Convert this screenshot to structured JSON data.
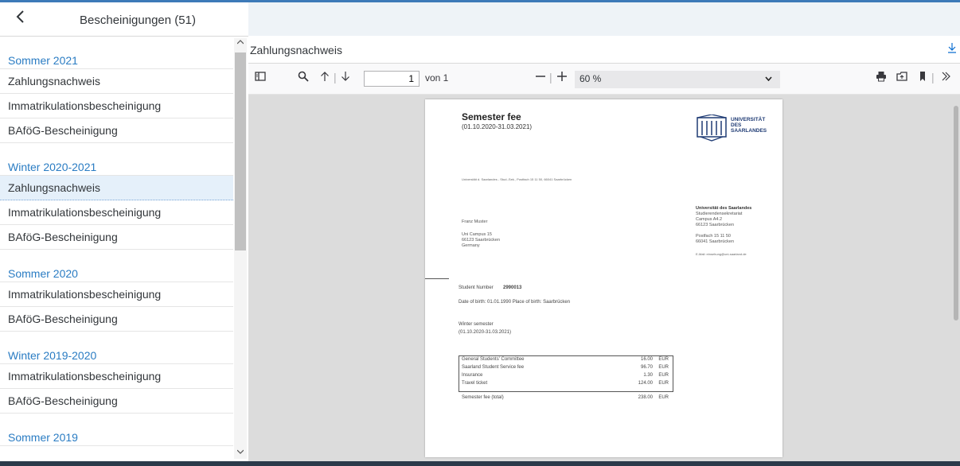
{
  "sidebar": {
    "title": "Bescheinigungen (51)",
    "groups": [
      {
        "heading": "Sommer 2021",
        "items": [
          "Zahlungsnachweis",
          "Immatrikulationsbescheinigung",
          "BAföG-Bescheinigung"
        ]
      },
      {
        "heading": "Winter 2020-2021",
        "items": [
          "Zahlungsnachweis",
          "Immatrikulationsbescheinigung",
          "BAföG-Bescheinigung"
        ]
      },
      {
        "heading": "Sommer 2020",
        "items": [
          "Immatrikulationsbescheinigung",
          "BAföG-Bescheinigung"
        ]
      },
      {
        "heading": "Winter 2019-2020",
        "items": [
          "Immatrikulationsbescheinigung",
          "BAföG-Bescheinigung"
        ]
      },
      {
        "heading": "Sommer 2019",
        "items": []
      }
    ]
  },
  "document": {
    "title": "Zahlungsnachweis"
  },
  "toolbar": {
    "page_value": "1",
    "page_of": "von 1",
    "zoom": "60 %"
  },
  "pdf": {
    "heading": "Semester fee",
    "period": "(01.10.2020-31.03.2021)",
    "logo_line1": "UNIVERSITÄT",
    "logo_line2": "DES",
    "logo_line3": "SAARLANDES",
    "sender_line": "Universität d. Saarlandes - Stud.-Sek., Postfach 15 11 50, 66041 Saarbrücken",
    "recipient_name": "Franz Muster",
    "recipient_addr1": "Uni Campus  15",
    "recipient_addr2": "66123   Saarbrücken",
    "recipient_country": "Germany",
    "uni_name": "Universität des Saarlandes",
    "uni_dept": "Studierendensekretariat",
    "uni_campus": "Campus A4.2",
    "uni_city": "66123 Saarbrücken",
    "uni_pobox": "Postfach 15 11 50",
    "uni_pocity": "66041 Saarbrücken",
    "uni_email": "E-Mail: einsehung@uni-saarland.de",
    "student_number_label": "Student Number",
    "student_number": "2990013",
    "birth_line": "Date of birth: 01.01.1990   Place of birth: Saarbrücken",
    "semester_label": "Winter semester",
    "semester_period": "(01.10.2020-31.03.2021)",
    "fees": [
      {
        "name": "General Students' Committee",
        "amount": "16.00",
        "currency": "EUR"
      },
      {
        "name": "Saarland Student Service fee",
        "amount": "96.70",
        "currency": "EUR"
      },
      {
        "name": "Insurance",
        "amount": "1.30",
        "currency": "EUR"
      },
      {
        "name": "Travel ticket",
        "amount": "124.00",
        "currency": "EUR"
      }
    ],
    "total_label": "Semester fee (total)",
    "total_amount": "238.00",
    "total_currency": "EUR"
  },
  "icons": {
    "back": "chevron-left-icon",
    "sidebar_toggle": "sidebar-toggle-icon",
    "search": "search-icon",
    "up": "arrow-up-icon",
    "down": "arrow-down-icon",
    "zoom_out": "minus-icon",
    "zoom_in": "plus-icon",
    "print": "print-icon",
    "open": "open-file-icon",
    "bookmark": "bookmark-icon",
    "more": "double-chevron-right-icon",
    "download": "download-icon"
  },
  "colors": {
    "accent": "#0a6ed1",
    "selected_row": "#e5f0fa",
    "top_line": "#3d7ab8"
  }
}
